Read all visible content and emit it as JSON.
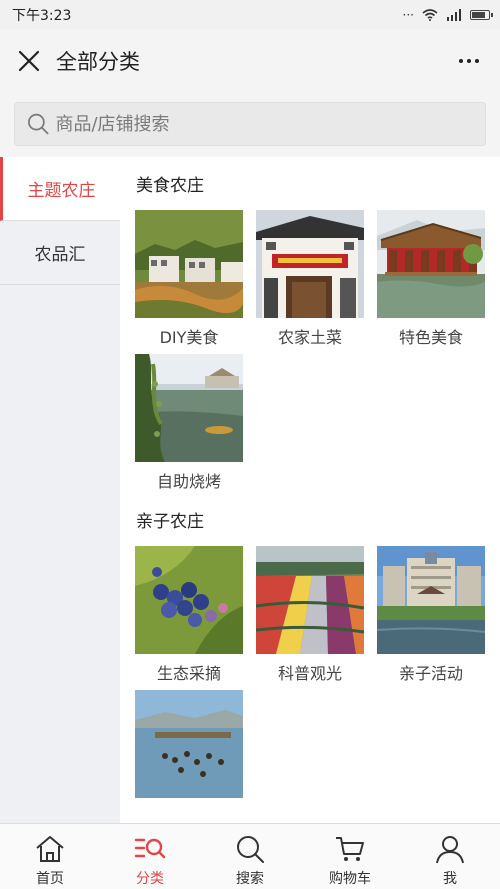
{
  "status": {
    "time": "下午3:23"
  },
  "header": {
    "title": "全部分类"
  },
  "search": {
    "placeholder": "商品/店铺搜索"
  },
  "sidebar": {
    "items": [
      {
        "label": "主题农庄"
      },
      {
        "label": "农品汇"
      }
    ]
  },
  "sections": [
    {
      "title": "美食农庄",
      "items": [
        {
          "label": "DIY美食"
        },
        {
          "label": "农家土菜"
        },
        {
          "label": "特色美食"
        },
        {
          "label": "自助烧烤"
        }
      ]
    },
    {
      "title": "亲子农庄",
      "items": [
        {
          "label": "生态采摘"
        },
        {
          "label": "科普观光"
        },
        {
          "label": "亲子活动"
        }
      ]
    }
  ],
  "tabbar": {
    "items": [
      {
        "label": "首页"
      },
      {
        "label": "分类"
      },
      {
        "label": "搜索"
      },
      {
        "label": "购物车"
      },
      {
        "label": "我"
      }
    ]
  },
  "colors": {
    "accent": "#e04646",
    "sidebar_bg": "#eef0f3"
  }
}
